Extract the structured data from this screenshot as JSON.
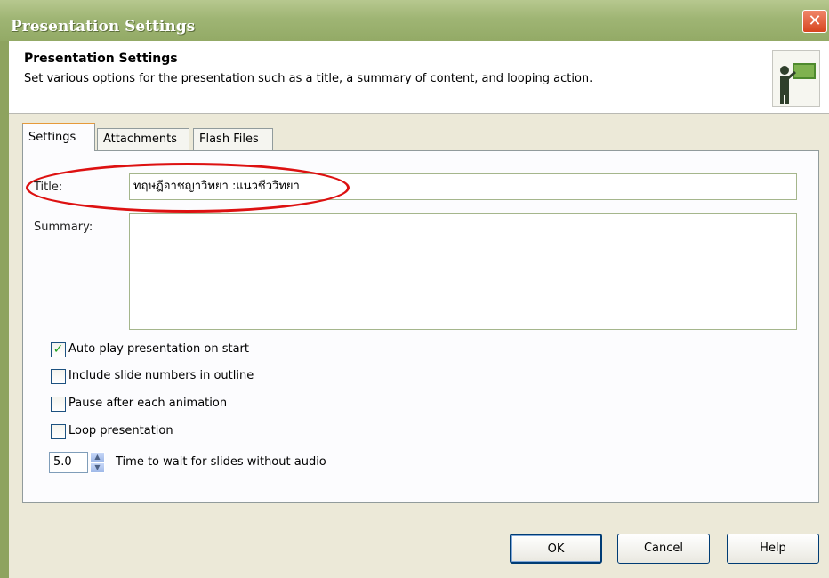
{
  "window": {
    "title": "Presentation Settings"
  },
  "header": {
    "title": "Presentation Settings",
    "description": "Set various options for the presentation such as a title, a summary of content, and looping action."
  },
  "tabs": [
    {
      "label": "Settings",
      "active": true
    },
    {
      "label": "Attachments",
      "active": false
    },
    {
      "label": "Flash Files",
      "active": false
    }
  ],
  "form": {
    "title_label": "Title:",
    "title_value": "ทฤษฎีอาชญาวิทยา :แนวชีววิทยา",
    "summary_label": "Summary:",
    "summary_value": ""
  },
  "options": [
    {
      "label": "Auto play presentation on start",
      "checked": true
    },
    {
      "label": "Include slide numbers in outline",
      "checked": false
    },
    {
      "label": "Pause after each animation",
      "checked": false
    },
    {
      "label": "Loop presentation",
      "checked": false
    }
  ],
  "wait_time": {
    "value": "5.0",
    "label": "Time to wait for slides without audio"
  },
  "buttons": {
    "ok": "OK",
    "cancel": "Cancel",
    "help": "Help"
  },
  "colors": {
    "titlebar": "#9fb574",
    "annotation": "#dd1111",
    "check": "#21a121"
  },
  "icons": {
    "close": "close-icon",
    "header": "presenter-icon"
  }
}
